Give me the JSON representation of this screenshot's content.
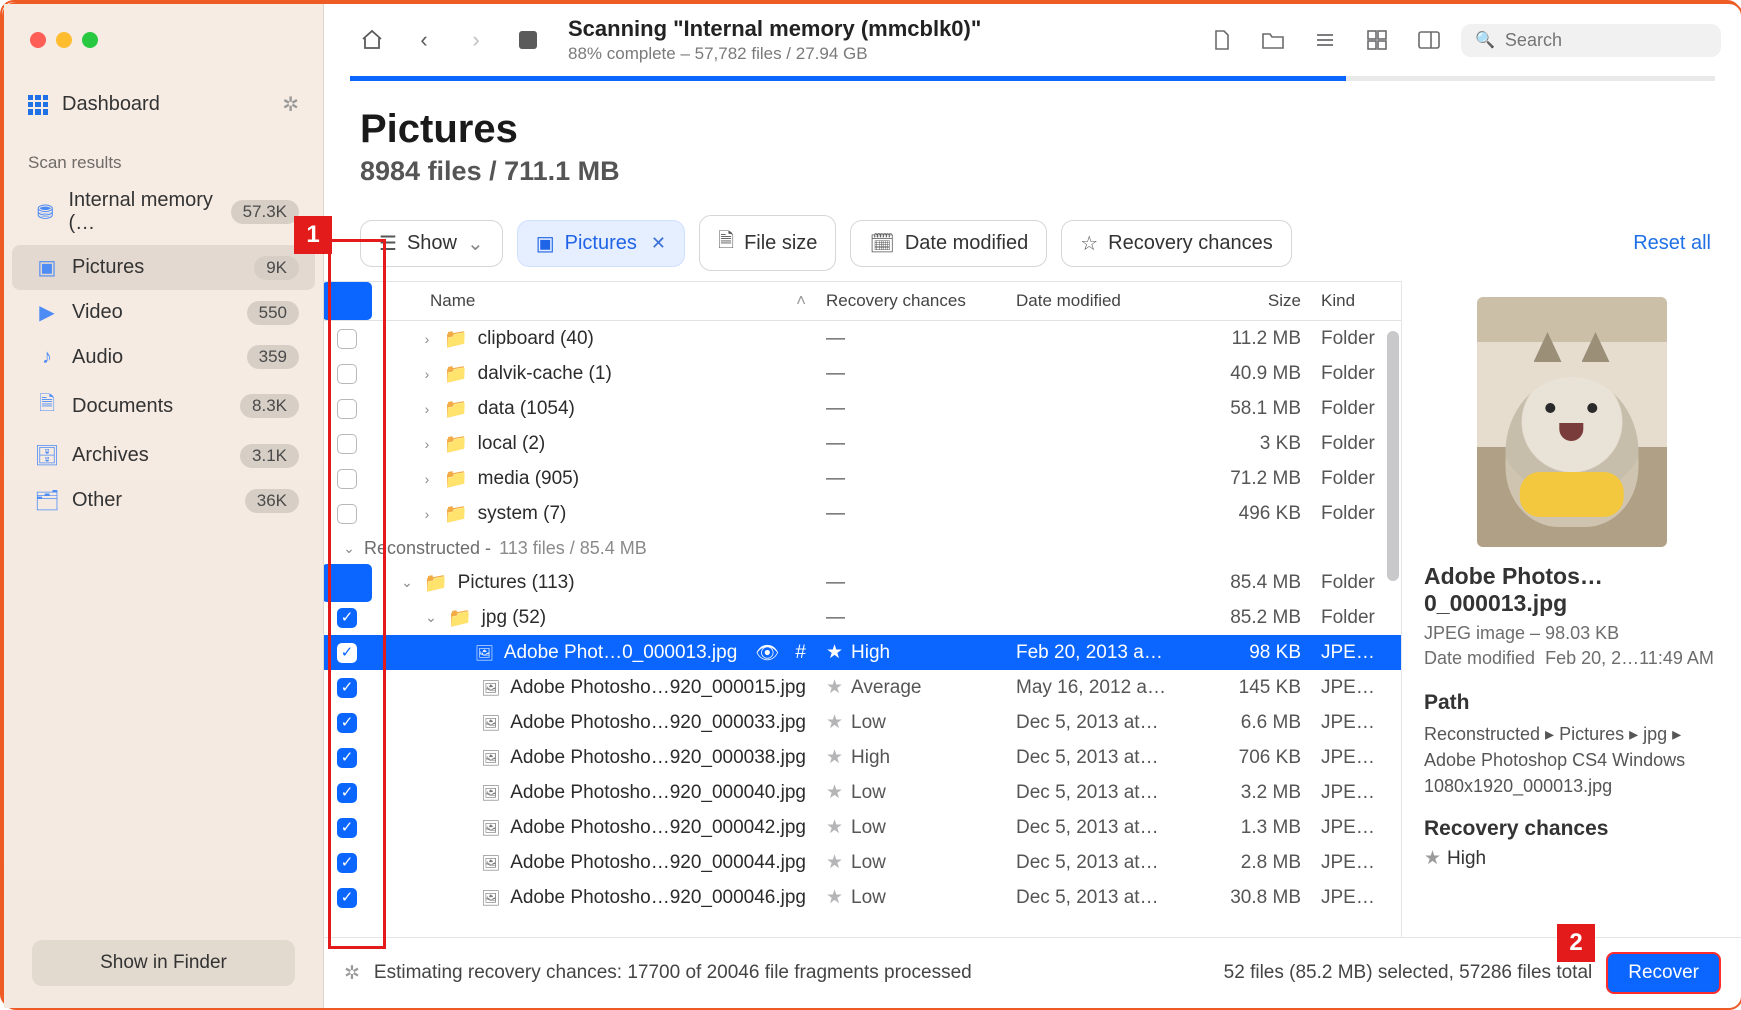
{
  "traffic": {
    "red": "",
    "yellow": "",
    "green": ""
  },
  "sidebar": {
    "dashboard": "Dashboard",
    "section": "Scan results",
    "items": [
      {
        "icon": "drive",
        "label": "Internal memory (…",
        "badge": "57.3K",
        "active": false
      },
      {
        "icon": "image",
        "label": "Pictures",
        "badge": "9K",
        "active": true
      },
      {
        "icon": "video",
        "label": "Video",
        "badge": "550",
        "active": false
      },
      {
        "icon": "audio",
        "label": "Audio",
        "badge": "359",
        "active": false
      },
      {
        "icon": "doc",
        "label": "Documents",
        "badge": "8.3K",
        "active": false
      },
      {
        "icon": "archive",
        "label": "Archives",
        "badge": "3.1K",
        "active": false
      },
      {
        "icon": "other",
        "label": "Other",
        "badge": "36K",
        "active": false
      }
    ],
    "show_in_finder": "Show in Finder"
  },
  "toolbar": {
    "title": "Scanning \"Internal memory (mmcblk0)\"",
    "subtitle": "88% complete – 57,782 files / 27.94 GB",
    "search_placeholder": "Search"
  },
  "heading": {
    "title": "Pictures",
    "subtitle": "8984 files / 711.1 MB"
  },
  "filters": {
    "show": "Show",
    "pictures": "Pictures",
    "filesize": "File size",
    "datemod": "Date modified",
    "recchance": "Recovery chances",
    "reset": "Reset all"
  },
  "columns": {
    "name": "Name",
    "rec": "Recovery chances",
    "date": "Date modified",
    "size": "Size",
    "kind": "Kind"
  },
  "folders": [
    {
      "name": "clipboard (40)",
      "size": "11.2 MB",
      "kind": "Folder"
    },
    {
      "name": "dalvik-cache (1)",
      "size": "40.9 MB",
      "kind": "Folder"
    },
    {
      "name": "data (1054)",
      "size": "58.1 MB",
      "kind": "Folder"
    },
    {
      "name": "local (2)",
      "size": "3 KB",
      "kind": "Folder"
    },
    {
      "name": "media (905)",
      "size": "71.2 MB",
      "kind": "Folder"
    },
    {
      "name": "system (7)",
      "size": "496 KB",
      "kind": "Folder"
    }
  ],
  "group": {
    "label": "Reconstructed - ",
    "detail": "113 files / 85.4 MB"
  },
  "recon_folders": [
    {
      "name": "Pictures (113)",
      "size": "85.4 MB",
      "kind": "Folder",
      "indent": 0,
      "cb": "dash",
      "open": true
    },
    {
      "name": "jpg (52)",
      "size": "85.2 MB",
      "kind": "Folder",
      "indent": 1,
      "cb": "check",
      "open": true
    }
  ],
  "files": [
    {
      "name": "Adobe Phot…0_000013.jpg",
      "rec": "High",
      "date": "Feb 20, 2013 a…",
      "size": "98 KB",
      "kind": "JPEG…",
      "selected": true,
      "indent": 2
    },
    {
      "name": "Adobe Photosho…920_000015.jpg",
      "rec": "Average",
      "date": "May 16, 2012 a…",
      "size": "145 KB",
      "kind": "JPEG…",
      "selected": false,
      "indent": 2
    },
    {
      "name": "Adobe Photosho…920_000033.jpg",
      "rec": "Low",
      "date": "Dec 5, 2013 at…",
      "size": "6.6 MB",
      "kind": "JPEG…",
      "selected": false,
      "indent": 2
    },
    {
      "name": "Adobe Photosho…920_000038.jpg",
      "rec": "High",
      "date": "Dec 5, 2013 at…",
      "size": "706 KB",
      "kind": "JPEG…",
      "selected": false,
      "indent": 2
    },
    {
      "name": "Adobe Photosho…920_000040.jpg",
      "rec": "Low",
      "date": "Dec 5, 2013 at…",
      "size": "3.2 MB",
      "kind": "JPEG…",
      "selected": false,
      "indent": 2
    },
    {
      "name": "Adobe Photosho…920_000042.jpg",
      "rec": "Low",
      "date": "Dec 5, 2013 at…",
      "size": "1.3 MB",
      "kind": "JPEG…",
      "selected": false,
      "indent": 2
    },
    {
      "name": "Adobe Photosho…920_000044.jpg",
      "rec": "Low",
      "date": "Dec 5, 2013 at…",
      "size": "2.8 MB",
      "kind": "JPEG…",
      "selected": false,
      "indent": 2
    },
    {
      "name": "Adobe Photosho…920_000046.jpg",
      "rec": "Low",
      "date": "Dec 5, 2013 at…",
      "size": "30.8 MB",
      "kind": "JPEG…",
      "selected": false,
      "indent": 2
    }
  ],
  "preview": {
    "title": "Adobe Photos…0_000013.jpg",
    "meta1": "JPEG image – 98.03 KB",
    "meta2_label": "Date modified",
    "meta2_value": "Feb 20, 2…11:49 AM",
    "path_title": "Path",
    "path": "Reconstructed ▸ Pictures ▸ jpg ▸ Adobe Photoshop CS4 Windows 1080x1920_000013.jpg",
    "rec_title": "Recovery chances",
    "rec_value": "High"
  },
  "status": {
    "estimating": "Estimating recovery chances: 17700 of 20046 file fragments processed",
    "selection": "52 files (85.2 MB) selected, 57286 files total",
    "recover": "Recover"
  },
  "annotations": {
    "a1": "1",
    "a2": "2"
  }
}
